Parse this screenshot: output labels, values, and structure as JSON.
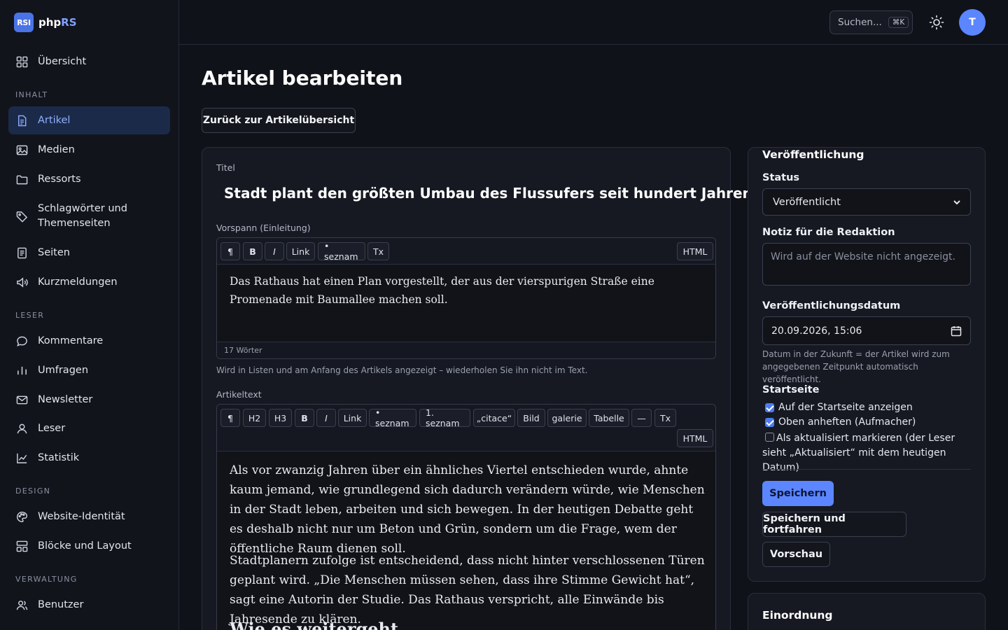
{
  "brand": {
    "badge": "RSI",
    "name_prefix": "php",
    "name_suffix": "RS"
  },
  "sidebar": {
    "overview": "Übersicht",
    "sections": {
      "content": "INHALT",
      "readers": "LESER",
      "design": "DESIGN",
      "admin": "VERWALTUNG"
    },
    "items": [
      {
        "label": "Artikel",
        "icon": "document-icon"
      },
      {
        "label": "Medien",
        "icon": "image-icon"
      },
      {
        "label": "Ressorts",
        "icon": "folder-icon"
      },
      {
        "label": "Schlagwörter und Themenseiten",
        "icon": "tag-icon"
      },
      {
        "label": "Seiten",
        "icon": "page-icon"
      },
      {
        "label": "Kurzmeldungen",
        "icon": "megaphone-icon"
      },
      {
        "label": "Kommentare",
        "icon": "comment-icon"
      },
      {
        "label": "Umfragen",
        "icon": "bar-chart-icon"
      },
      {
        "label": "Newsletter",
        "icon": "mail-icon"
      },
      {
        "label": "Leser",
        "icon": "user-icon"
      },
      {
        "label": "Statistik",
        "icon": "line-chart-icon"
      },
      {
        "label": "Website-Identität",
        "icon": "palette-icon"
      },
      {
        "label": "Blöcke und Layout",
        "icon": "layout-icon"
      },
      {
        "label": "Benutzer",
        "icon": "users-icon"
      }
    ]
  },
  "topbar": {
    "search_placeholder": "Suchen...",
    "search_shortcut": "⌘K",
    "avatar_initial": "T"
  },
  "main": {
    "title": "Artikel bearbeiten",
    "back_label": "Zurück zur Artikelübersicht",
    "title_label": "Titel",
    "title_value": "Stadt plant den größten Umbau des Flussufers seit hundert Jahren",
    "lead_label": "Vorspann (Einleitung)",
    "lead_toolbar": [
      "¶",
      "B",
      "I",
      "Link",
      "• seznam",
      "Tx"
    ],
    "html_label": "HTML",
    "lead_text": "Das Rathaus hat einen Plan vorgestellt, der aus der vierspurigen Straße eine Promenade mit Baumallee machen soll.",
    "lead_wordcount": "17 Wörter",
    "lead_hint": "Wird in Listen und am Anfang des Artikels angezeigt – wiederholen Sie ihn nicht im Text.",
    "body_label": "Artikeltext",
    "body_toolbar": [
      "¶",
      "H2",
      "H3",
      "B",
      "I",
      "Link",
      "• seznam",
      "1. seznam",
      "„citace“",
      "Bild",
      "galerie",
      "Tabelle",
      "—",
      "Tx"
    ],
    "body_paragraphs": [
      "Als vor zwanzig Jahren über ein ähnliches Viertel entschieden wurde, ahnte kaum jemand, wie grundlegend sich dadurch verändern würde, wie Menschen in der Stadt leben, arbeiten und sich bewegen. In der heutigen Debatte geht es deshalb nicht nur um Beton und Grün, sondern um die Frage, wem der öffentliche Raum dienen soll.",
      "Stadtplanern zufolge ist entscheidend, dass nicht hinter verschlossenen Türen geplant wird. „Die Menschen müssen sehen, dass ihre Stimme Gewicht hat“, sagt eine Autorin der Studie. Das Rathaus verspricht, alle Einwände bis Jahresende zu klären."
    ],
    "body_heading": "Wie es weitergeht"
  },
  "publish": {
    "title": "Veröffentlichung",
    "status_label": "Status",
    "status_value": "Veröffentlicht",
    "note_label": "Notiz für die Redaktion",
    "note_placeholder": "Wird auf der Website nicht angezeigt.",
    "date_label": "Veröffentlichungsdatum",
    "date_value": "20.09.2026, 15:06",
    "date_hint": "Datum in der Zukunft = der Artikel wird zum angegebenen Zeitpunkt automatisch veröffentlicht.",
    "homepage_label": "Startseite",
    "checkboxes": [
      {
        "label": "Auf der Startseite anzeigen",
        "checked": true
      },
      {
        "label": "Oben anheften (Aufmacher)",
        "checked": true
      },
      {
        "label": "Als aktualisiert markieren (der Leser sieht „Aktualisiert“ mit dem heutigen Datum)",
        "checked": false
      }
    ],
    "save": "Speichern",
    "save_continue": "Speichern und fortfahren",
    "preview": "Vorschau"
  },
  "classification": {
    "title": "Einordnung"
  },
  "colors": {
    "accent": "#5b86ff",
    "active_nav_bg": "#1c2a4a",
    "background": "#10121a"
  }
}
